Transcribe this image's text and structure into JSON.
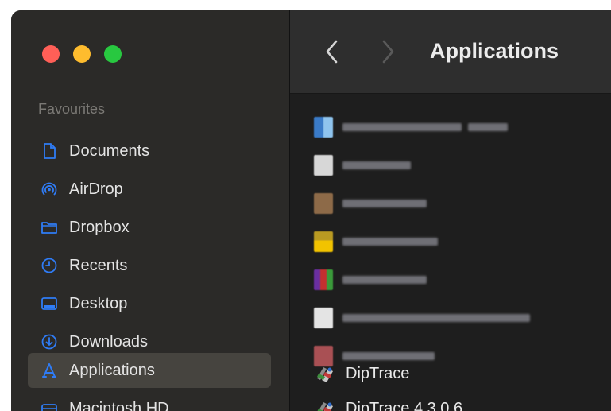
{
  "sidebar": {
    "section_title": "Favourites",
    "items": [
      {
        "label": "Documents",
        "icon": "document-icon"
      },
      {
        "label": "AirDrop",
        "icon": "airdrop-icon"
      },
      {
        "label": "Dropbox",
        "icon": "folder-icon"
      },
      {
        "label": "Recents",
        "icon": "clock-icon"
      },
      {
        "label": "Desktop",
        "icon": "desktop-icon"
      },
      {
        "label": "Downloads",
        "icon": "download-icon"
      },
      {
        "label": "Applications",
        "icon": "applications-icon",
        "selected": true
      },
      {
        "label": "Macintosh HD",
        "icon": "disk-icon"
      }
    ]
  },
  "toolbar": {
    "title": "Applications"
  },
  "files": [
    {
      "name": "DipTrace",
      "icon": "diptrace-app-icon"
    },
    {
      "name": "DipTrace 4.3.0.6",
      "icon": "diptrace-app-icon"
    }
  ],
  "colors": {
    "accent": "#2f7cf6",
    "sidebar_bg": "#2b2a28",
    "content_bg": "#1e1e1e",
    "selected_bg": "#46443f"
  }
}
